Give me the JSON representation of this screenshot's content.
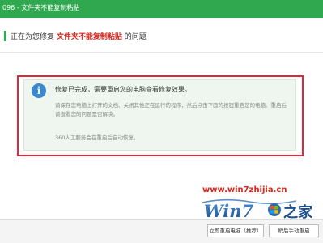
{
  "window": {
    "title": "096 - 文件夹不能复制粘贴"
  },
  "heading": {
    "prefix": "正在为您修复",
    "highlight": "文件夹不能复制粘贴",
    "suffix": "的问题"
  },
  "message": {
    "icon": "info-icon",
    "title": "修复已完成，需要重启您的电脑查看修复效果。",
    "description": "请保存您电脑上打开的文档、关闭其他正在运行的程序，然后点击下面的按钮重启您的电脑。重启后请查看您的问题是否解决。",
    "note": "360人工服务会在重启后自动恢复。"
  },
  "watermark": {
    "url": "www.win7zhijia.cn",
    "logo_text": "Win7之家"
  },
  "footer": {
    "restart_button": "立即重启电脑（推荐）",
    "later_button": "稍后手动重启"
  },
  "colors": {
    "accent": "#2fa84f",
    "highlight": "#d9261c",
    "annotation_box": "#e0283a",
    "info_icon": "#3a88cf"
  }
}
